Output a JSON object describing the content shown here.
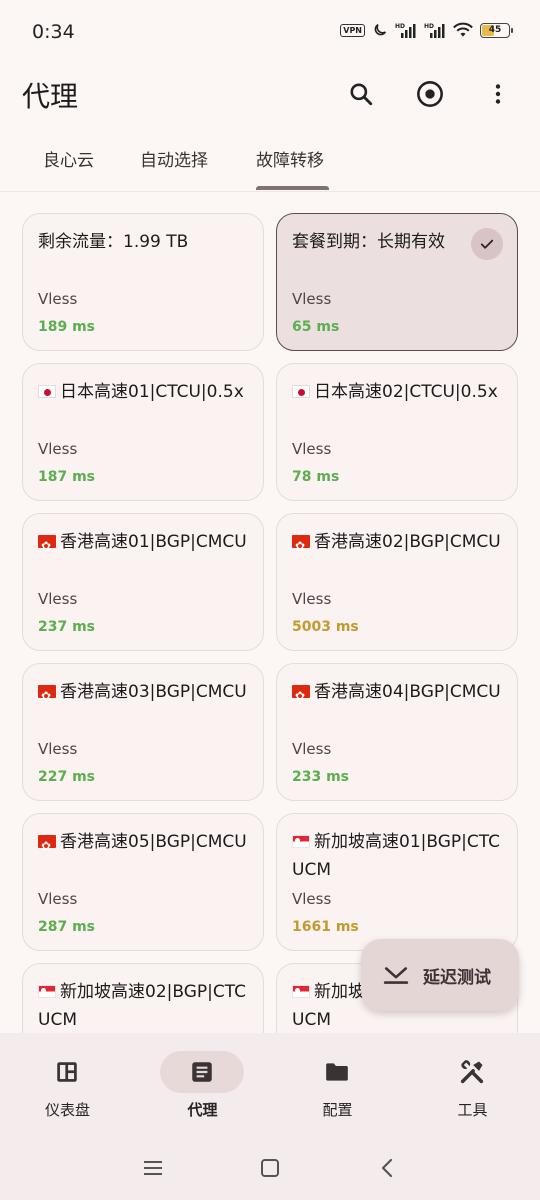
{
  "status_bar": {
    "time": "0:34",
    "vpn_label": "VPN",
    "battery_level": "45",
    "icons": [
      "vpn-icon",
      "moon-icon",
      "signal-hd-icon",
      "signal-hd-icon",
      "wifi-icon",
      "battery-icon"
    ]
  },
  "app_bar": {
    "title": "代理",
    "actions": [
      "search-icon",
      "target-icon",
      "more-vert-icon"
    ]
  },
  "tabs": {
    "items": [
      {
        "label": "良心云"
      },
      {
        "label": "自动选择"
      },
      {
        "label": "故障转移"
      }
    ],
    "selected": "故障转移"
  },
  "proxies": [
    {
      "name": "剩余流量：1.99 TB",
      "flag": "",
      "type": "Vless",
      "delay": "189 ms",
      "delay_color": "#5cae4e",
      "selected": false
    },
    {
      "name": "套餐到期：长期有效",
      "flag": "",
      "type": "Vless",
      "delay": "65 ms",
      "delay_color": "#5cae4e",
      "selected": true
    },
    {
      "name": "日本高速01|CTCU|0.5x",
      "flag": "jp",
      "type": "Vless",
      "delay": "187 ms",
      "delay_color": "#5cae4e",
      "selected": false
    },
    {
      "name": "日本高速02|CTCU|0.5x",
      "flag": "jp",
      "type": "Vless",
      "delay": "78 ms",
      "delay_color": "#5cae4e",
      "selected": false
    },
    {
      "name": "香港高速01|BGP|CMCU",
      "flag": "hk",
      "type": "Vless",
      "delay": "237 ms",
      "delay_color": "#5cae4e",
      "selected": false
    },
    {
      "name": "香港高速02|BGP|CMCU",
      "flag": "hk",
      "type": "Vless",
      "delay": "5003 ms",
      "delay_color": "#c19a30",
      "selected": false
    },
    {
      "name": "香港高速03|BGP|CMCU",
      "flag": "hk",
      "type": "Vless",
      "delay": "227 ms",
      "delay_color": "#5cae4e",
      "selected": false
    },
    {
      "name": "香港高速04|BGP|CMCU",
      "flag": "hk",
      "type": "Vless",
      "delay": "233 ms",
      "delay_color": "#5cae4e",
      "selected": false
    },
    {
      "name": "香港高速05|BGP|CMCU",
      "flag": "hk",
      "type": "Vless",
      "delay": "287 ms",
      "delay_color": "#5cae4e",
      "selected": false
    },
    {
      "name": "新加坡高速01|BGP|CTCUCM",
      "flag": "sg",
      "type": "Vless",
      "delay": "1661 ms",
      "delay_color": "#c19a30",
      "selected": false
    },
    {
      "name": "新加坡高速02|BGP|CTCUCM",
      "flag": "sg",
      "type": "",
      "delay": "",
      "delay_color": "#5cae4e",
      "selected": false
    },
    {
      "name": "新加坡高速03|BGP|CTCUCM",
      "flag": "sg",
      "type": "",
      "delay": "",
      "delay_color": "#5cae4e",
      "selected": false
    }
  ],
  "fab": {
    "label": "延迟测试",
    "icon": "speed-test-icon"
  },
  "bottom_nav": {
    "items": [
      {
        "label": "仪表盘",
        "icon": "dashboard-icon"
      },
      {
        "label": "代理",
        "icon": "article-icon"
      },
      {
        "label": "配置",
        "icon": "folder-icon"
      },
      {
        "label": "工具",
        "icon": "tools-icon"
      }
    ],
    "active": "代理"
  },
  "system_nav": [
    "recents-icon",
    "home-icon",
    "back-icon"
  ]
}
